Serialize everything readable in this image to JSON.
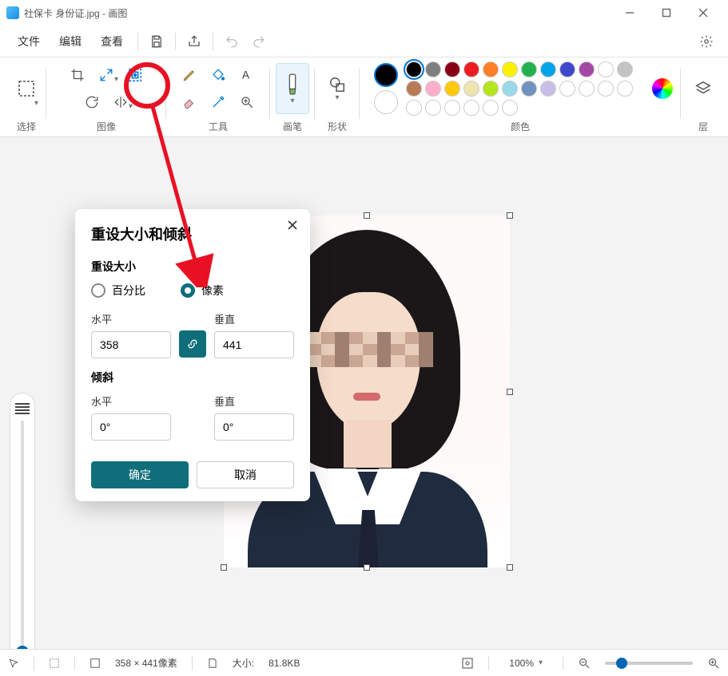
{
  "titlebar": {
    "title": "社保卡 身份证.jpg - 画图"
  },
  "menu": {
    "file": "文件",
    "edit": "编辑",
    "view": "查看"
  },
  "ribbon": {
    "select_label": "选择",
    "image_label": "图像",
    "tools_label": "工具",
    "brushes_label": "画笔",
    "shapes_label": "形状",
    "colors_label": "颜色",
    "layers_label": "层"
  },
  "colors": {
    "row1": [
      "#000000",
      "#7f7f7f",
      "#880015",
      "#ed1c24",
      "#ff7f27",
      "#fff200",
      "#22b14c",
      "#00a2e8",
      "#3f48cc",
      "#a349a4"
    ],
    "row2": [
      "#ffffff",
      "#c3c3c3",
      "#b97a57",
      "#ffaec9",
      "#ffc90e",
      "#efe4b0",
      "#b5e61d",
      "#99d9ea",
      "#7092be",
      "#c8bfe7"
    ],
    "row3": [
      "#ffffff",
      "#ffffff",
      "#ffffff",
      "#ffffff",
      "#ffffff",
      "#ffffff",
      "#ffffff",
      "#ffffff",
      "#ffffff",
      "#ffffff"
    ],
    "primary": "#000000",
    "secondary": "#ffffff"
  },
  "dialog": {
    "title": "重设大小和倾斜",
    "resize_section": "重设大小",
    "opt_percent": "百分比",
    "opt_pixels": "像素",
    "label_h": "水平",
    "label_v": "垂直",
    "val_h": "358",
    "val_v": "441",
    "skew_section": "倾斜",
    "skew_h": "0°",
    "skew_v": "0°",
    "ok": "确定",
    "cancel": "取消"
  },
  "statusbar": {
    "dims": "358 × 441像素",
    "size_label": "大小:",
    "size_value": "81.8KB",
    "zoom": "100%"
  }
}
